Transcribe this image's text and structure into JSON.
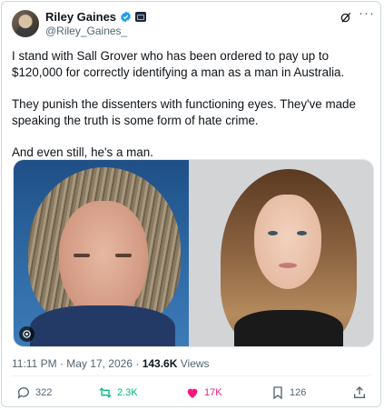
{
  "author": {
    "display_name": "Riley Gaines",
    "handle": "@Riley_Gaines_"
  },
  "tweet": {
    "paragraphs": [
      "I stand with Sall Grover who has been ordered to pay up to $120,000 for correctly identifying a man as a man in Australia.",
      "They punish the dissenters with functioning eyes. They've made speaking the truth is some form of hate crime.",
      "And even still, he's a man."
    ],
    "time": "11:11 PM",
    "date": "May 17, 2026",
    "views_count": "143.6K",
    "views_label": "Views"
  },
  "actions": {
    "replies": "322",
    "reposts": "2.3K",
    "likes": "17K",
    "bookmarks": "126"
  },
  "colors": {
    "verified": "#1d9bf0",
    "repost": "#00ba7c",
    "like": "#f91880",
    "muted": "#536471"
  },
  "icons": [
    "verified-badge-icon",
    "affiliate-badge-icon",
    "grok-icon",
    "more-icon",
    "alt-badge-icon",
    "reply-icon",
    "repost-icon",
    "like-icon",
    "bookmark-icon",
    "share-icon"
  ]
}
